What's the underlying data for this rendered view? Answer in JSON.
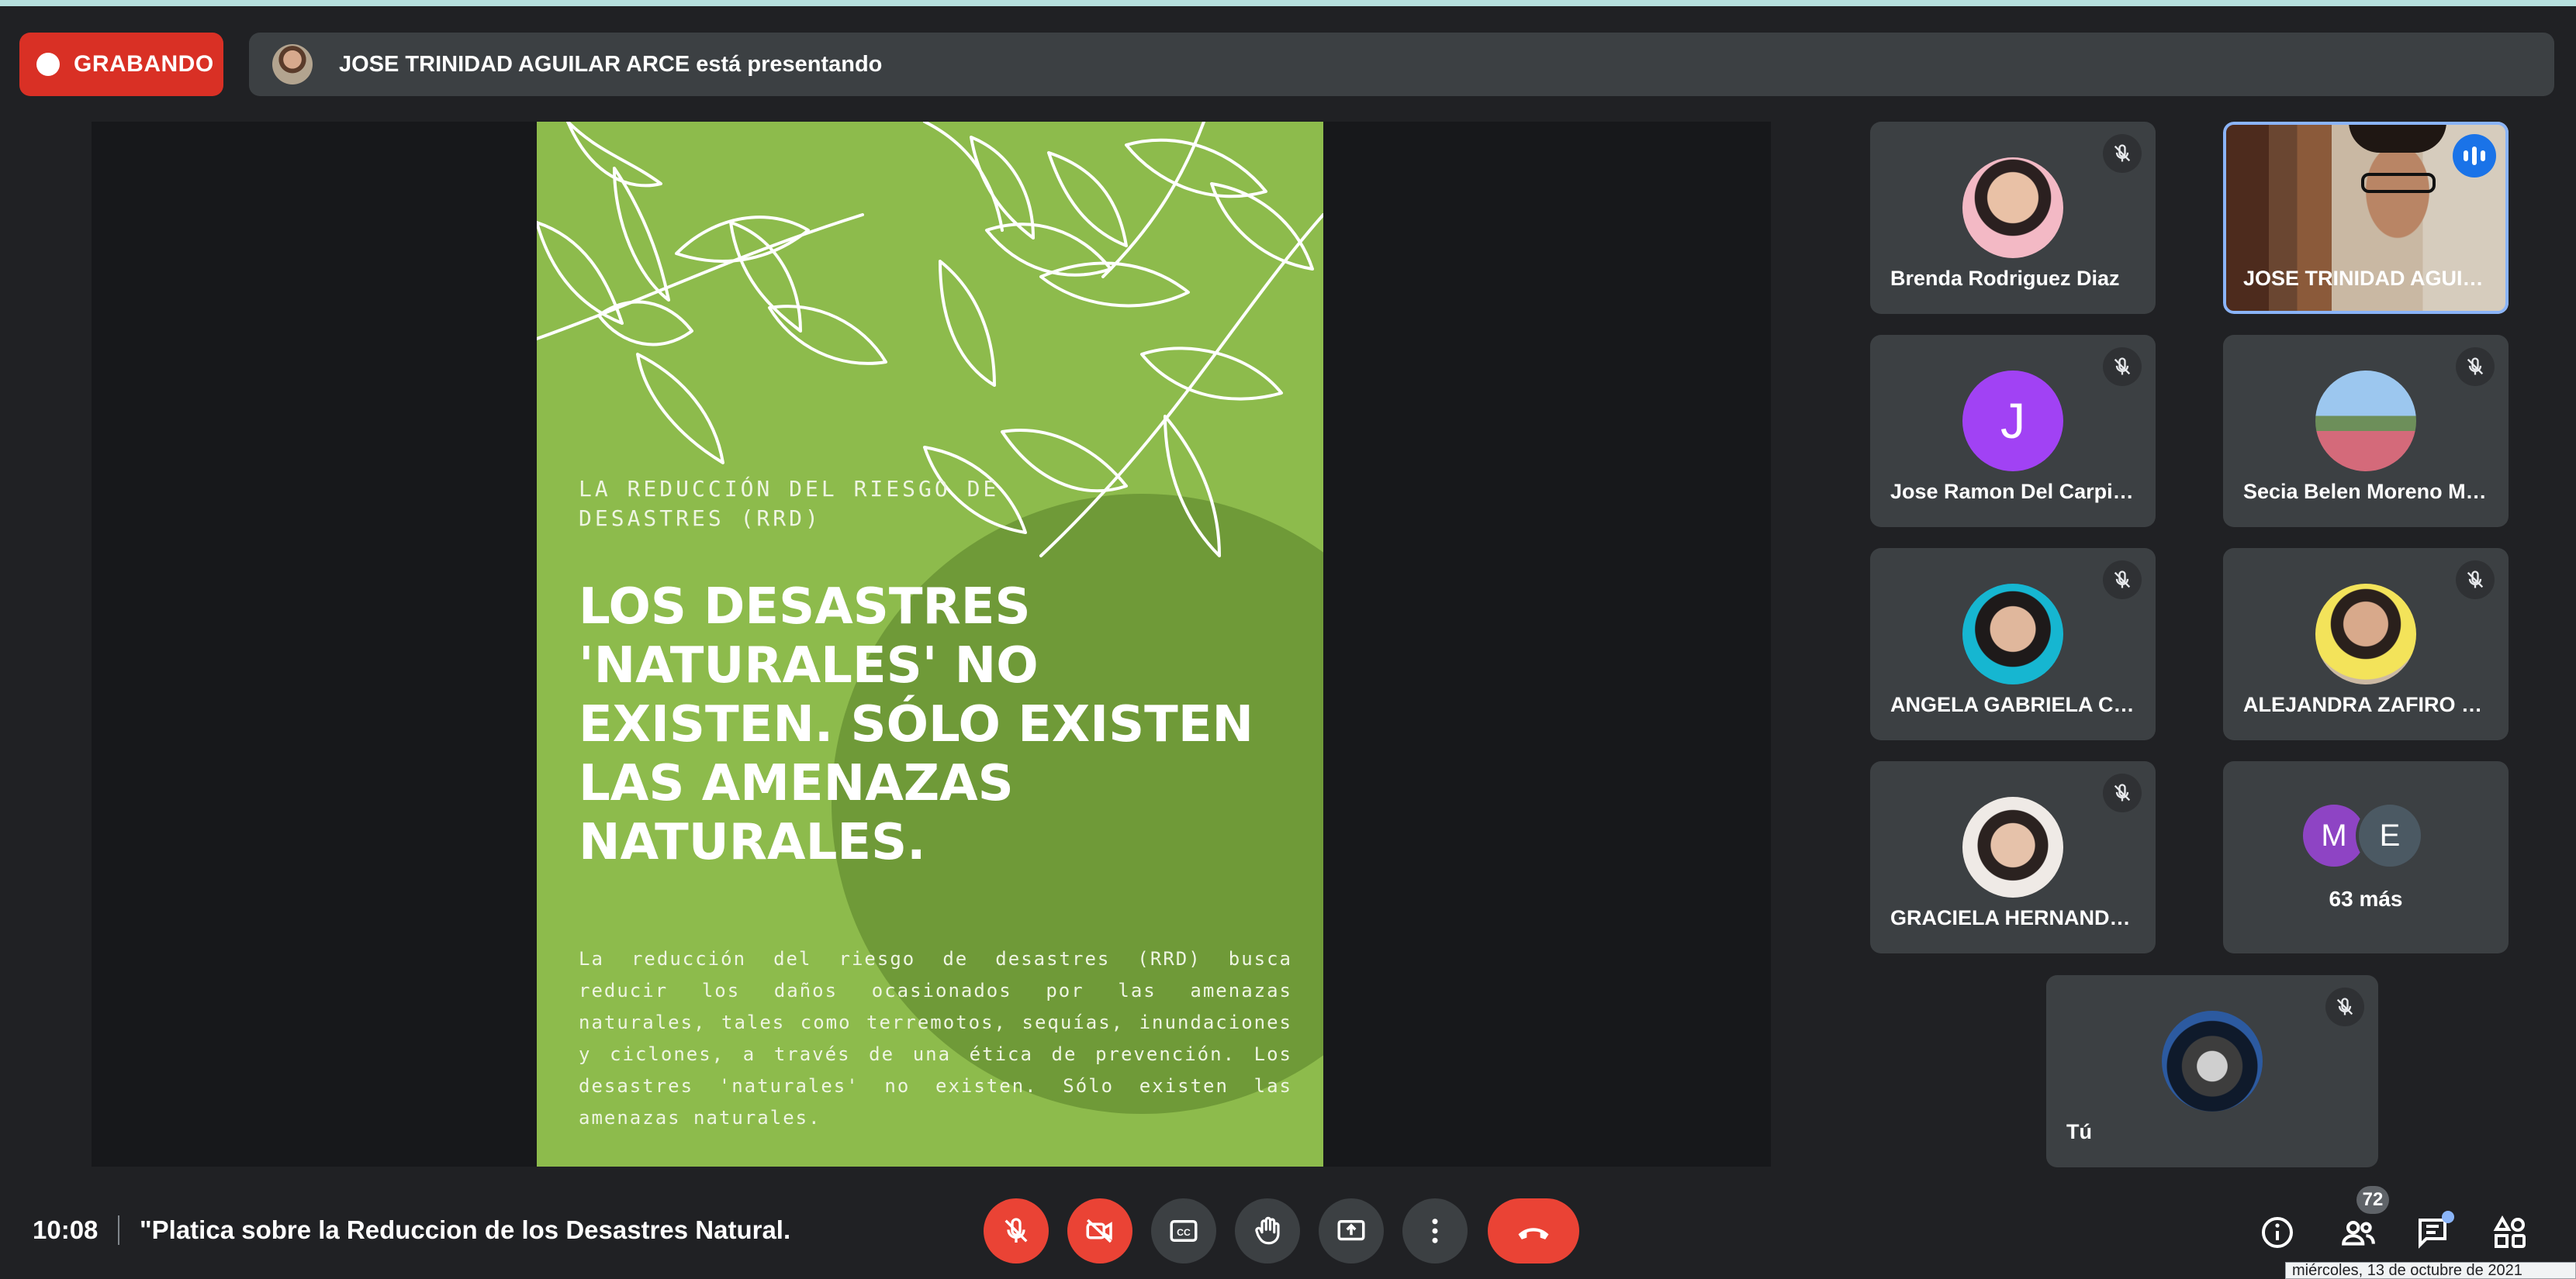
{
  "header": {
    "recording_label": "GRABANDO",
    "presenting_text": "JOSE TRINIDAD AGUILAR ARCE está presentando"
  },
  "slide": {
    "kicker": "LA REDUCCIÓN DEL RIESGO DE DESASTRES (RRD)",
    "title": "LOS DESASTRES 'NATURALES' NO EXISTEN. SÓLO EXISTEN LAS AMENAZAS NATURALES.",
    "body": "La reducción del riesgo de desastres (RRD) busca reducir los daños ocasionados por las amenazas naturales, tales como terremotos, sequías, inundaciones y ciclones, a través de una ética de prevención. Los desastres 'naturales' no existen. Sólo existen las amenazas naturales.",
    "colors": {
      "background": "#8dbb4c",
      "circle": "#6f9a38"
    }
  },
  "participants": [
    {
      "name": "Brenda Rodriguez Diaz",
      "muted": true
    },
    {
      "name": "JOSE TRINIDAD AGUILA...",
      "muted": false,
      "speaking": true,
      "video": true
    },
    {
      "name": "Jose Ramon Del Carpio P...",
      "initial": "J",
      "muted": true
    },
    {
      "name": "Secia Belen Moreno Mart...",
      "muted": true
    },
    {
      "name": "ANGELA GABRIELA CRUZ...",
      "muted": true
    },
    {
      "name": "ALEJANDRA ZAFIRO MO...",
      "muted": true
    },
    {
      "name": "GRACIELA HERNANDEZ ...",
      "muted": true
    },
    {
      "name": "Tú",
      "muted": true
    }
  ],
  "overflow_tile": {
    "initial_1": "M",
    "initial_2": "E",
    "label": "63 más"
  },
  "footer": {
    "time": "10:08",
    "meeting_title": "\"Platica sobre la Reduccion de los Desastres Natural...",
    "people_count": "72",
    "date_tooltip": "miércoles, 13 de octubre de 2021"
  },
  "controls": {
    "mic": "mic-off-icon",
    "camera": "camera-off-icon",
    "captions": "captions-icon",
    "raise_hand": "raise-hand-icon",
    "present": "present-screen-icon",
    "more": "more-options-icon",
    "end_call": "end-call-icon",
    "details": "info-icon",
    "people": "people-icon",
    "chat": "chat-icon",
    "activities": "activities-icon"
  },
  "accent_colors": {
    "recording": "#d93025",
    "active_speaker": "#8ab4f8",
    "end_call": "#ea4335"
  }
}
